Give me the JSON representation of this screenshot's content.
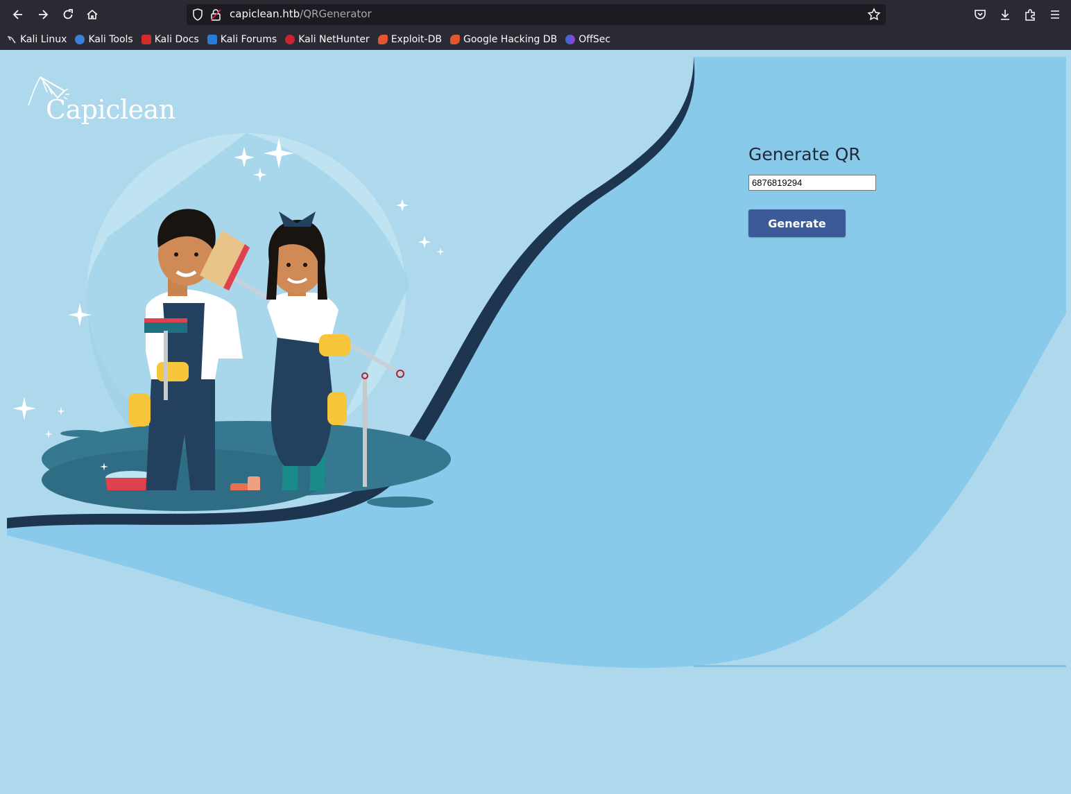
{
  "browser": {
    "url_host": "capiclean.htb",
    "url_path": "/QRGenerator",
    "bookmarks": [
      {
        "label": "Kali Linux",
        "icon": "kali-dragon-icon"
      },
      {
        "label": "Kali Tools",
        "icon": "kali-tools-icon"
      },
      {
        "label": "Kali Docs",
        "icon": "kali-docs-icon"
      },
      {
        "label": "Kali Forums",
        "icon": "kali-forums-icon"
      },
      {
        "label": "Kali NetHunter",
        "icon": "kali-nethunter-icon"
      },
      {
        "label": "Exploit-DB",
        "icon": "exploit-db-icon"
      },
      {
        "label": "Google Hacking DB",
        "icon": "ghdb-icon"
      },
      {
        "label": "OffSec",
        "icon": "offsec-icon"
      }
    ]
  },
  "page": {
    "logo_text": "Capiclean",
    "form": {
      "title": "Generate QR",
      "input_value": "6876819294",
      "button_label": "Generate"
    }
  },
  "colors": {
    "page_bg": "#aed8eb",
    "panel_blue": "#89c9e9",
    "dark_wave": "#1e3550",
    "button": "#3d5a98"
  }
}
